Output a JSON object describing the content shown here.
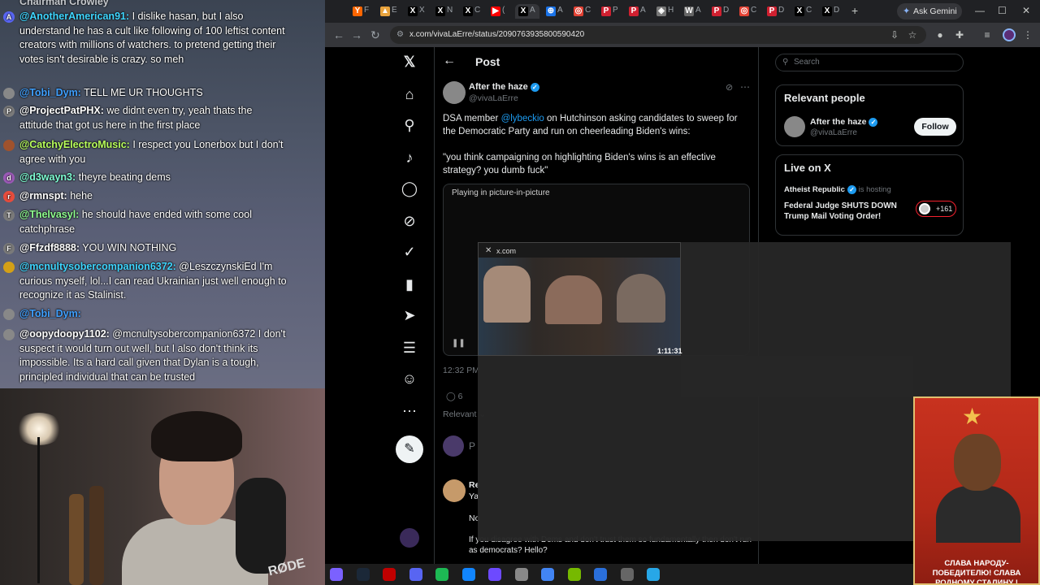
{
  "chat": {
    "top_partial": "Chairman Crowley",
    "messages": [
      {
        "badge": "A",
        "badge_color": "#5865f2",
        "user": "@AnotherAmerican91:",
        "user_color": "#3fd6ff",
        "text": "I dislike hasan, but I also understand he has a cult like following of 100 leftist content creators with millions of watchers. to pretend getting their votes isn't desirable is crazy. so meh"
      },
      {
        "badge": "",
        "badge_color": "#888888",
        "user": "@Tobi_Dym:",
        "user_color": "#3fa0ff",
        "text": "TELL ME UR THOUGHTS"
      },
      {
        "badge": "P",
        "badge_color": "#7a7a7a",
        "user": "@ProjectPatPHX:",
        "user_color": "#ffffff",
        "text": "we didnt even try, yeah thats the attitude that got us here in the first place"
      },
      {
        "badge": "",
        "badge_color": "#a0522d",
        "user": "@CatchyElectroMusic:",
        "user_color": "#b9ff5c",
        "text": "I respect you Lonerbox but I don't agree with you"
      },
      {
        "badge": "d",
        "badge_color": "#9b59b6",
        "user": "@d3wayn3:",
        "user_color": "#7fffd4",
        "text": "theyre beating dems"
      },
      {
        "badge": "r",
        "badge_color": "#e74c3c",
        "user": "@rmnspt:",
        "user_color": "#ffffff",
        "text": "hehe"
      },
      {
        "badge": "T",
        "badge_color": "#7a7a7a",
        "user": "@Thelvasyl:",
        "user_color": "#8fff8f",
        "text": "he should have ended with some cool catchphrase"
      },
      {
        "badge": "F",
        "badge_color": "#7a7a7a",
        "user": "@Ffzdf8888:",
        "user_color": "#ffffff",
        "text": "YOU WIN NOTHING"
      },
      {
        "badge": "",
        "badge_color": "#d4a017",
        "user": "@mcnultysobercompanion6372:",
        "user_color": "#3fd6ff",
        "text": "@LeszczynskiEd I'm curious myself, lol...I can read Ukrainian just well enough to recognize it as Stalinist."
      },
      {
        "badge": "",
        "badge_color": "#888888",
        "user": "@Tobi_Dym:",
        "user_color": "#3fa0ff",
        "text": ""
      },
      {
        "badge": "",
        "badge_color": "#888888",
        "user": "@oopydoopy1102:",
        "user_color": "#ffffff",
        "text": "@mcnultysobercompanion6372 I don't suspect it would turn out well, but I also don't think its impossible. Its a hard call given that Dylan is a tough, principled individual that can be trusted"
      }
    ]
  },
  "webcam": {
    "mic_brand": "RØDE"
  },
  "browser": {
    "tabs": [
      {
        "icon": "Y",
        "color": "#ff6600",
        "label": "F"
      },
      {
        "icon": "▲",
        "color": "#e8a33d",
        "label": "E"
      },
      {
        "icon": "X",
        "color": "#000000",
        "label": "X"
      },
      {
        "icon": "X",
        "color": "#000000",
        "label": "N"
      },
      {
        "icon": "X",
        "color": "#000000",
        "label": "C"
      },
      {
        "icon": "▶",
        "color": "#ff0000",
        "label": "("
      },
      {
        "icon": "X",
        "color": "#000000",
        "label": "A"
      },
      {
        "icon": "⊕",
        "color": "#1a73e8",
        "label": "A"
      },
      {
        "icon": "◎",
        "color": "#e34234",
        "label": "C"
      },
      {
        "icon": "P",
        "color": "#d02030",
        "label": "P"
      },
      {
        "icon": "P",
        "color": "#d02030",
        "label": "A"
      },
      {
        "icon": "◈",
        "color": "#777777",
        "label": "H"
      },
      {
        "icon": "W",
        "color": "#666666",
        "label": "A"
      },
      {
        "icon": "P",
        "color": "#d02030",
        "label": "D"
      },
      {
        "icon": "◎",
        "color": "#e34234",
        "label": "C"
      },
      {
        "icon": "P",
        "color": "#d02030",
        "label": "D"
      },
      {
        "icon": "X",
        "color": "#000000",
        "label": "C"
      },
      {
        "icon": "X",
        "color": "#000000",
        "label": "D"
      }
    ],
    "new_tab": "+",
    "gemini_label": "Ask Gemini",
    "url": "x.com/vivaLaErre/status/2090763935800590420"
  },
  "x": {
    "page_title": "Post",
    "author_name": "After the haze",
    "author_handle": "@vivaLaErre",
    "tweet_pre": "DSA member ",
    "tweet_mention": "@lybeckio",
    "tweet_post": " on Hutchinson asking candidates to sweep for the Democratic Party and run on cheerleading Biden's wins:",
    "tweet_quote": "\"you think campaigning on highlighting Biden's wins is an effective strategy? you dumb fuck\"",
    "pip_text": "Playing in picture-in-picture",
    "post_time": "12:32 PM",
    "reply_count": "6",
    "relevant_label": "Relevant",
    "composer_placeholder": "P",
    "reply_name": "Re",
    "reply_line2": "Ya",
    "reply_line3": "No",
    "reply_line4": "If you disagree with Dems and don't trust them so fundamentally then don't run as democrats? Hello?",
    "search_placeholder": "Search",
    "relevant_people_title": "Relevant people",
    "rel_name": "After the haze",
    "rel_handle": "@vivaLaErre",
    "follow_label": "Follow",
    "live_title": "Live on X",
    "live_host": "Atheist Republic",
    "live_host_sub": "is hosting",
    "live_headline": "Federal Judge SHUTS DOWN Trump Mail Voting Order!",
    "live_count": "+161"
  },
  "pip": {
    "domain": "x.com",
    "time": "1:11:31"
  },
  "poster": {
    "caption": "СЛАВА НАРОДУ-ПОБЕДИТЕЛЮ! СЛАВА РОДНОМУ СТАЛИНУ !"
  },
  "taskbar": {
    "icons": [
      "edge-icon",
      "steam-icon",
      "obs-icon",
      "discord-icon",
      "spotify-icon",
      "bluesky-icon",
      "proton-icon",
      "gear-icon",
      "chrome-icon",
      "nvidia-icon",
      "app-icon",
      "headset-icon",
      "telegram-icon"
    ],
    "colors": [
      "#7b61ff",
      "#1b2838",
      "#c00000",
      "#5865f2",
      "#1db954",
      "#1185fe",
      "#6d4aff",
      "#888888",
      "#4285f4",
      "#76b900",
      "#2a6fdb",
      "#666666",
      "#27a7e7"
    ]
  }
}
